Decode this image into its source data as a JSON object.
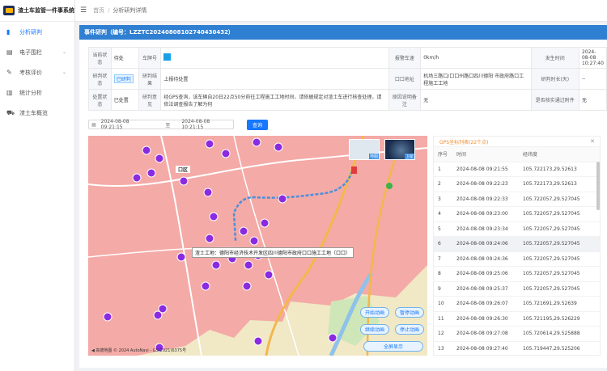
{
  "app": {
    "title": "渣土车监管一件事系统"
  },
  "sidebar": {
    "items": [
      {
        "label": "分析研判",
        "icon": "bar-chart-icon",
        "active": true
      },
      {
        "label": "电子围栏",
        "icon": "fence-icon",
        "expandable": true
      },
      {
        "label": "考核评价",
        "icon": "rating-icon",
        "expandable": true
      },
      {
        "label": "统计分析",
        "icon": "stats-icon"
      },
      {
        "label": "渣土车概览",
        "icon": "truck-icon"
      }
    ]
  },
  "header": {
    "breadcrumb_home": "首页",
    "breadcrumb_current": "分析研判详情"
  },
  "panel": {
    "title": "事件研判（编号：LZZTC20240808102740430432）"
  },
  "info": {
    "r1": {
      "l1": "当前状态",
      "v1": "待处",
      "l2": "车牌号",
      "l3": "报警车速",
      "v3": "0km/h",
      "l4": "发生时间",
      "v4": "2024-08-08 10:27:40"
    },
    "r2": {
      "l1": "研判状态",
      "v1": "已研判",
      "l2": "研判结果",
      "v2": "上报待处置",
      "l3": "口口地址",
      "v3": "机场三路口/口口州路口四川德阳 市政府路口工程施工工地",
      "l4": "研判时长(天)",
      "v4": "--"
    },
    "r3": {
      "l1": "处置状态",
      "v1": "已处置",
      "l2": "研判意见",
      "v2": "经GPS查询，该车辆自20日22点50分前往工程施工工地时间，请依据规定对渣土车进行核查处理，请依法调查报告了解为何",
      "l3": "原因说明备注",
      "v3": "无",
      "l4": "是否核实通过附件",
      "v4": "无"
    }
  },
  "search": {
    "start": "2024-08-08 09:21:15",
    "to": "至",
    "end": "2024-08-08 10:21:15",
    "button": "查询"
  },
  "map": {
    "district": "口区",
    "callout": "渣土工地：德阳市经济技术开发区四川德阳市政府口口施工工地（口口）",
    "thumb_map": "地图",
    "thumb_sat": "卫星",
    "footer": "◀ 高德地图 © 2024 AutoNavi - GS(2021)6375号",
    "buttons": {
      "start": "开始动画",
      "pause": "暂停动画",
      "resume": "继续动画",
      "stop": "停止动画",
      "fullscreen": "全屏显示"
    },
    "colors": {
      "zone": "#f6a7a6",
      "route": "#4b8fdd",
      "marker": "#8a2be2"
    }
  },
  "gps": {
    "title": "GPS坐标列表(22个点)",
    "columns": [
      "序号",
      "时间",
      "经纬度"
    ],
    "rows": [
      [
        "1",
        "2024-08-08 09:21:55",
        "105.722173,29.52613"
      ],
      [
        "2",
        "2024-08-08 09:22:23",
        "105.722173,29.52613"
      ],
      [
        "3",
        "2024-08-08 09:22:33",
        "105.722057,29.527045"
      ],
      [
        "4",
        "2024-08-08 09:23:00",
        "105.722057,29.527045"
      ],
      [
        "5",
        "2024-08-08 09:23:34",
        "105.722057,29.527045"
      ],
      [
        "6",
        "2024-08-08 09:24:06",
        "105.722057,29.527045"
      ],
      [
        "7",
        "2024-08-08 09:24:36",
        "105.722057,29.527045"
      ],
      [
        "8",
        "2024-08-08 09:25:06",
        "105.722057,29.527045"
      ],
      [
        "9",
        "2024-08-08 09:25:37",
        "105.722057,29.527045"
      ],
      [
        "10",
        "2024-08-08 09:26:07",
        "105.721691,29.52639"
      ],
      [
        "11",
        "2024-08-08 09:26:30",
        "105.721195,29.526229"
      ],
      [
        "12",
        "2024-08-08 09:27:08",
        "105.720614,29.525888"
      ],
      [
        "13",
        "2024-08-08 09:27:40",
        "105.719447,29.525206"
      ]
    ]
  }
}
